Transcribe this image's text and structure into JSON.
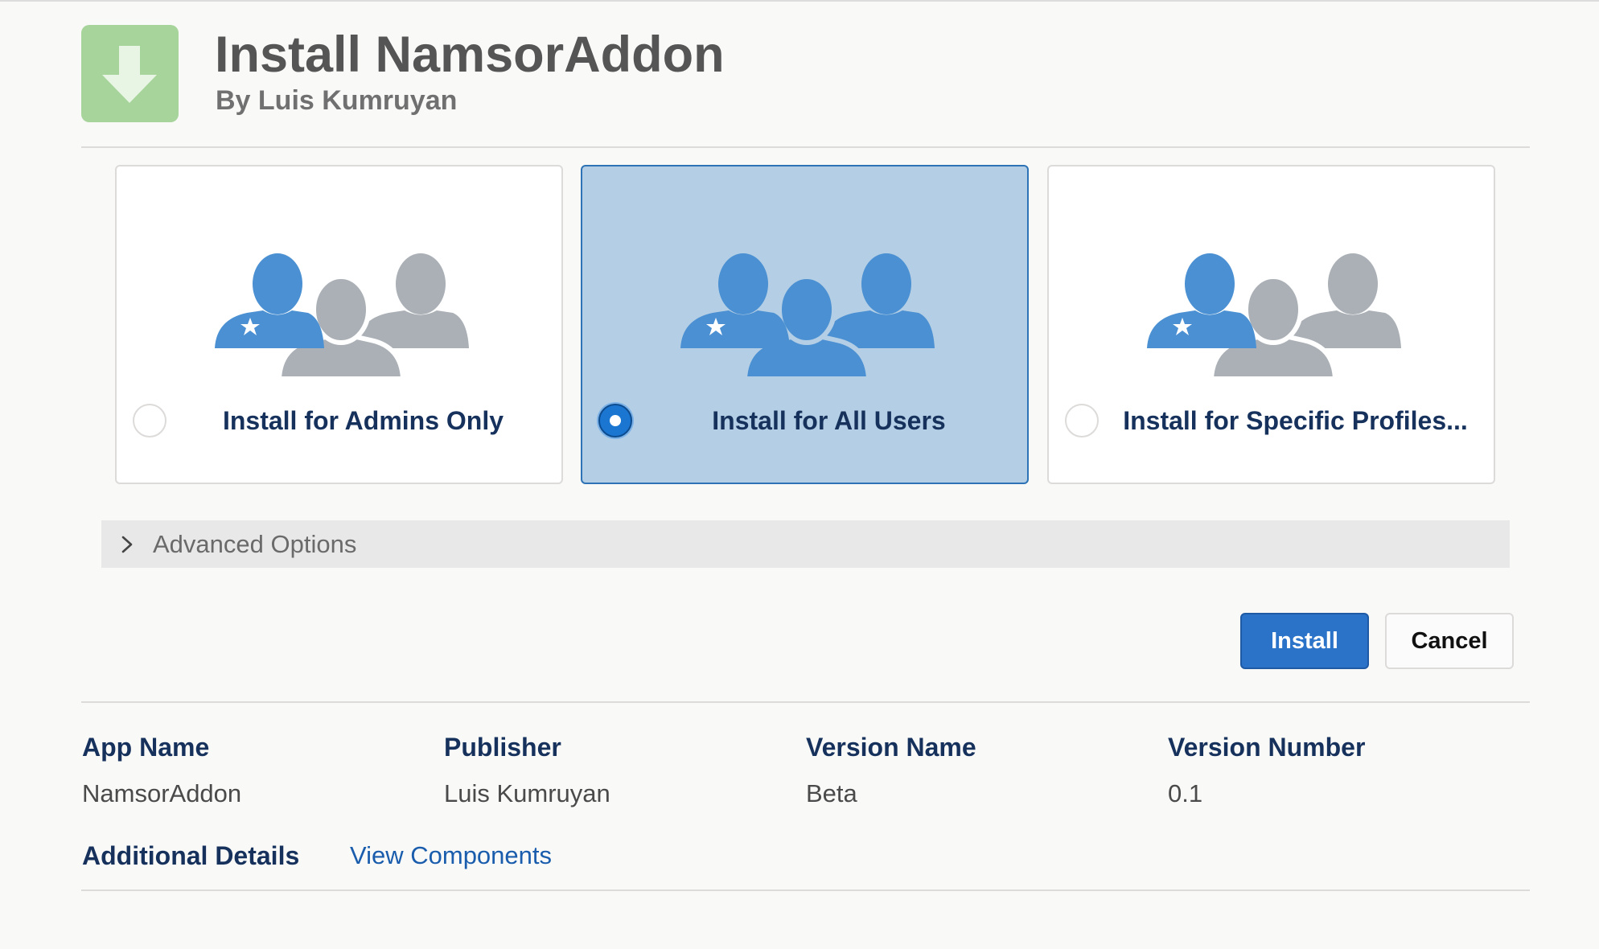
{
  "header": {
    "title": "Install NamsorAddon",
    "subtitle": "By Luis Kumruyan",
    "icon": "download-arrow-icon",
    "icon_color": "#a6d49b"
  },
  "install_options": [
    {
      "label": "Install for Admins Only",
      "selected": false,
      "icon": "admin-users-icon"
    },
    {
      "label": "Install for All Users",
      "selected": true,
      "icon": "all-users-icon"
    },
    {
      "label": "Install for Specific Profiles...",
      "selected": false,
      "icon": "profile-users-icon"
    }
  ],
  "advanced_options": {
    "label": "Advanced Options",
    "icon": "chevron-right-icon"
  },
  "actions": {
    "install_label": "Install",
    "cancel_label": "Cancel",
    "install_color": "#2b72c9"
  },
  "details": {
    "columns": [
      {
        "heading": "App Name",
        "value": "NamsorAddon"
      },
      {
        "heading": "Publisher",
        "value": "Luis Kumruyan"
      },
      {
        "heading": "Version Name",
        "value": "Beta"
      },
      {
        "heading": "Version Number",
        "value": "0.1"
      }
    ],
    "additional_label": "Additional Details",
    "view_components_label": "View Components"
  },
  "colors": {
    "selected_card_bg": "#b4cfe5",
    "heading_navy": "#16325c",
    "figure_blue": "#4a90d2",
    "figure_gray": "#aab0b6",
    "link_blue": "#1a5dad"
  }
}
